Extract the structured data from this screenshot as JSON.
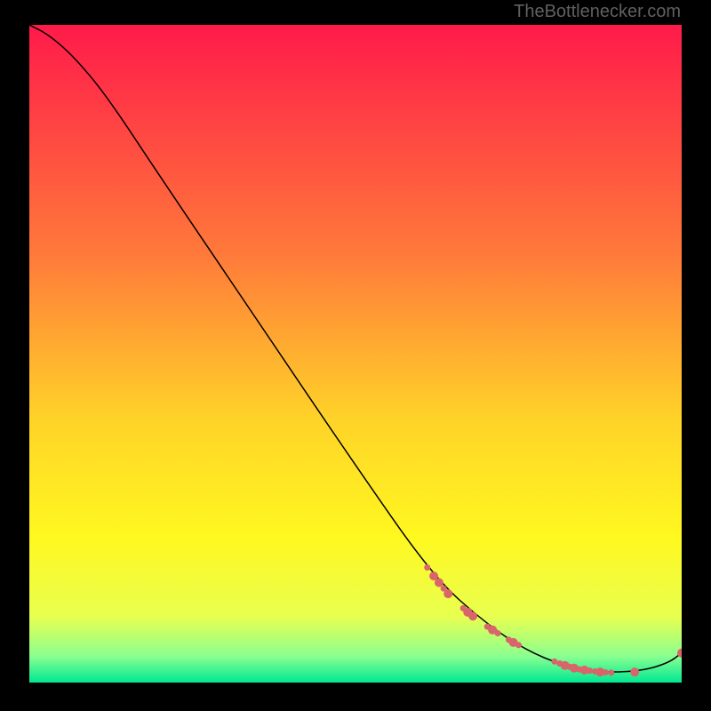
{
  "attribution": "TheBottlenecker.com",
  "chart_data": {
    "type": "line",
    "title": "",
    "xlabel": "",
    "ylabel": "",
    "xlim": [
      0,
      100
    ],
    "ylim": [
      0,
      100
    ],
    "background_gradient": {
      "stops": [
        {
          "offset": 0,
          "color": "#ff1a4a"
        },
        {
          "offset": 0.35,
          "color": "#ff7a3a"
        },
        {
          "offset": 0.6,
          "color": "#ffd328"
        },
        {
          "offset": 0.78,
          "color": "#fff820"
        },
        {
          "offset": 0.9,
          "color": "#e8ff50"
        },
        {
          "offset": 0.96,
          "color": "#8aff90"
        },
        {
          "offset": 1.0,
          "color": "#00e893"
        }
      ]
    },
    "series": [
      {
        "name": "curve",
        "color": "#000000",
        "points": [
          {
            "x": 0,
            "y": 100
          },
          {
            "x": 3,
            "y": 98.5
          },
          {
            "x": 7,
            "y": 95
          },
          {
            "x": 12,
            "y": 89
          },
          {
            "x": 20,
            "y": 77
          },
          {
            "x": 35,
            "y": 55
          },
          {
            "x": 50,
            "y": 33
          },
          {
            "x": 62,
            "y": 16
          },
          {
            "x": 70,
            "y": 9
          },
          {
            "x": 76,
            "y": 5
          },
          {
            "x": 82,
            "y": 2.5
          },
          {
            "x": 88,
            "y": 1.5
          },
          {
            "x": 94,
            "y": 1.8
          },
          {
            "x": 98,
            "y": 3
          },
          {
            "x": 100,
            "y": 4.5
          }
        ]
      }
    ],
    "markers": {
      "color": "#d9646a",
      "radius_small": 3.5,
      "radius_large": 5,
      "points": [
        {
          "x": 61,
          "y": 17.5,
          "r": 3.5
        },
        {
          "x": 62,
          "y": 16.2,
          "r": 5
        },
        {
          "x": 62.8,
          "y": 15.2,
          "r": 5
        },
        {
          "x": 63.5,
          "y": 14.3,
          "r": 3.5
        },
        {
          "x": 64.2,
          "y": 13.5,
          "r": 5
        },
        {
          "x": 66.5,
          "y": 11.3,
          "r": 3.5
        },
        {
          "x": 67.2,
          "y": 10.7,
          "r": 5
        },
        {
          "x": 68,
          "y": 10.1,
          "r": 5
        },
        {
          "x": 70.2,
          "y": 8.5,
          "r": 3.5
        },
        {
          "x": 71,
          "y": 8.0,
          "r": 5
        },
        {
          "x": 71.8,
          "y": 7.5,
          "r": 3.5
        },
        {
          "x": 73.5,
          "y": 6.5,
          "r": 3.5
        },
        {
          "x": 74.2,
          "y": 6.1,
          "r": 5
        },
        {
          "x": 75,
          "y": 5.7,
          "r": 3.5
        },
        {
          "x": 80.5,
          "y": 3.2,
          "r": 3.5
        },
        {
          "x": 81.3,
          "y": 2.9,
          "r": 3.5
        },
        {
          "x": 82.1,
          "y": 2.6,
          "r": 5
        },
        {
          "x": 82.8,
          "y": 2.4,
          "r": 3.5
        },
        {
          "x": 83.5,
          "y": 2.2,
          "r": 5
        },
        {
          "x": 84.3,
          "y": 2.0,
          "r": 3.5
        },
        {
          "x": 85.1,
          "y": 1.9,
          "r": 5
        },
        {
          "x": 85.9,
          "y": 1.8,
          "r": 3.5
        },
        {
          "x": 86.7,
          "y": 1.7,
          "r": 3.5
        },
        {
          "x": 87.5,
          "y": 1.6,
          "r": 5
        },
        {
          "x": 88.3,
          "y": 1.55,
          "r": 3.5
        },
        {
          "x": 89.2,
          "y": 1.5,
          "r": 3.5
        },
        {
          "x": 92.8,
          "y": 1.6,
          "r": 5
        },
        {
          "x": 100,
          "y": 4.5,
          "r": 5
        }
      ]
    }
  }
}
